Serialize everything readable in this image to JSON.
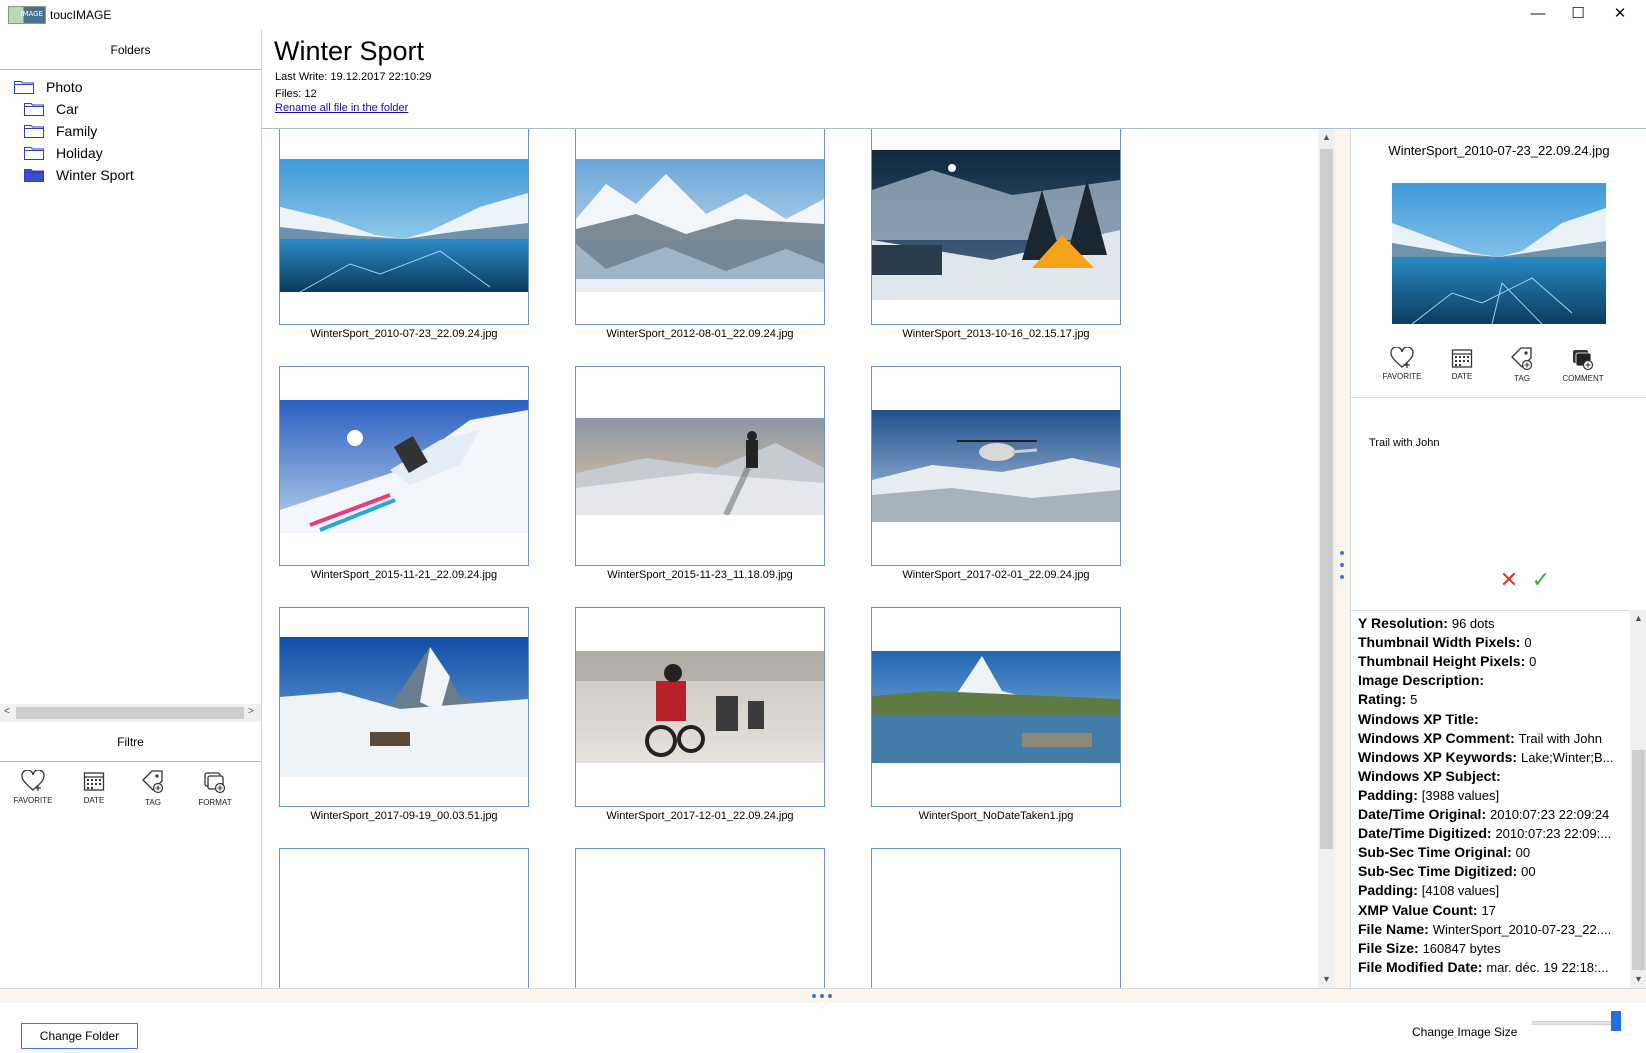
{
  "window": {
    "title": "toucIMAGE",
    "app_icon_text": "IMAGE",
    "minimize": "—",
    "maximize": "☐",
    "close": "✕"
  },
  "left_pane": {
    "folders_header": "Folders",
    "tree": [
      {
        "label": "Photo",
        "level": 0,
        "selected": false
      },
      {
        "label": "Car",
        "level": 1,
        "selected": false
      },
      {
        "label": "Family",
        "level": 1,
        "selected": false
      },
      {
        "label": "Holiday",
        "level": 1,
        "selected": false
      },
      {
        "label": "Winter Sport",
        "level": 1,
        "selected": true
      }
    ],
    "filter_header": "Filtre",
    "filter_icons": [
      {
        "icon": "heart-icon",
        "label": "FAVORITE"
      },
      {
        "icon": "calendar-icon",
        "label": "DATE"
      },
      {
        "icon": "tag-icon",
        "label": "TAG"
      },
      {
        "icon": "format-icon",
        "label": "FORMAT"
      }
    ]
  },
  "header": {
    "folder_title": "Winter Sport",
    "last_write": "Last Write: 19.12.2017 22:10:29",
    "files": "Files: 12",
    "rename_link": "Rename all file in the folder"
  },
  "thumbnails": [
    {
      "name": "WinterSport_2010-07-23_22.09.24.jpg",
      "scene": "lake"
    },
    {
      "name": "WinterSport_2012-08-01_22.09.24.jpg",
      "scene": "alps"
    },
    {
      "name": "WinterSport_2013-10-16_02.15.17.jpg",
      "scene": "night"
    },
    {
      "name": "WinterSport_2015-11-21_22.09.24.jpg",
      "scene": "skier"
    },
    {
      "name": "WinterSport_2015-11-23_11.18.09.jpg",
      "scene": "hiker"
    },
    {
      "name": "WinterSport_2017-02-01_22.09.24.jpg",
      "scene": "heli"
    },
    {
      "name": "WinterSport_2017-09-19_00.03.51.jpg",
      "scene": "matterhorn"
    },
    {
      "name": "WinterSport_2017-12-01_22.09.24.jpg",
      "scene": "moto"
    },
    {
      "name": "WinterSport_NoDateTaken1.jpg",
      "scene": "lakemtn"
    },
    {
      "name": "",
      "scene": "partial1"
    },
    {
      "name": "",
      "scene": "partial2"
    },
    {
      "name": "",
      "scene": "partial3"
    }
  ],
  "right_pane": {
    "preview_name": "WinterSport_2010-07-23_22.09.24.jpg",
    "actions": [
      {
        "icon": "heart-icon",
        "label": "FAVORITE"
      },
      {
        "icon": "calendar-icon",
        "label": "DATE"
      },
      {
        "icon": "tag-icon",
        "label": "TAG"
      },
      {
        "icon": "comment-icon",
        "label": "COMMENT"
      }
    ],
    "comment_text": "Trail with John",
    "cancel_symbol": "✕",
    "confirm_symbol": "✓",
    "metadata": [
      {
        "key": "Y Resolution:",
        "value": "96 dots"
      },
      {
        "key": "Thumbnail Width Pixels:",
        "value": "0"
      },
      {
        "key": "Thumbnail Height Pixels:",
        "value": "0"
      },
      {
        "key": "Image Description:",
        "value": ""
      },
      {
        "key": "Rating:",
        "value": "5"
      },
      {
        "key": "Windows XP Title:",
        "value": ""
      },
      {
        "key": "Windows XP Comment:",
        "value": "Trail with John"
      },
      {
        "key": "Windows XP Keywords:",
        "value": "Lake;Winter;B..."
      },
      {
        "key": "Windows XP Subject:",
        "value": ""
      },
      {
        "key": "Padding:",
        "value": "[3988 values]"
      },
      {
        "key": "Date/Time Original:",
        "value": "2010:07:23 22:09:24"
      },
      {
        "key": "Date/Time Digitized:",
        "value": "2010:07:23 22:09:..."
      },
      {
        "key": "Sub-Sec Time Original:",
        "value": "00"
      },
      {
        "key": "Sub-Sec Time Digitized:",
        "value": "00"
      },
      {
        "key": "Padding:",
        "value": "[4108 values]"
      },
      {
        "key": "XMP Value Count:",
        "value": "17"
      },
      {
        "key": "File Name:",
        "value": "WinterSport_2010-07-23_22...."
      },
      {
        "key": "File Size:",
        "value": "160847 bytes"
      },
      {
        "key": "File Modified Date:",
        "value": "mar. déc. 19 22:18:..."
      }
    ]
  },
  "bottom": {
    "change_folder": "Change Folder",
    "size_label": "Change Image Size",
    "size_slider_fraction": 0.95
  },
  "colors": {
    "accent": "#3b78d8",
    "tile_border": "#6d8fd4",
    "splitter": "#fbf5ee",
    "cancel": "#e03a2a",
    "confirm": "#3cae3c"
  }
}
